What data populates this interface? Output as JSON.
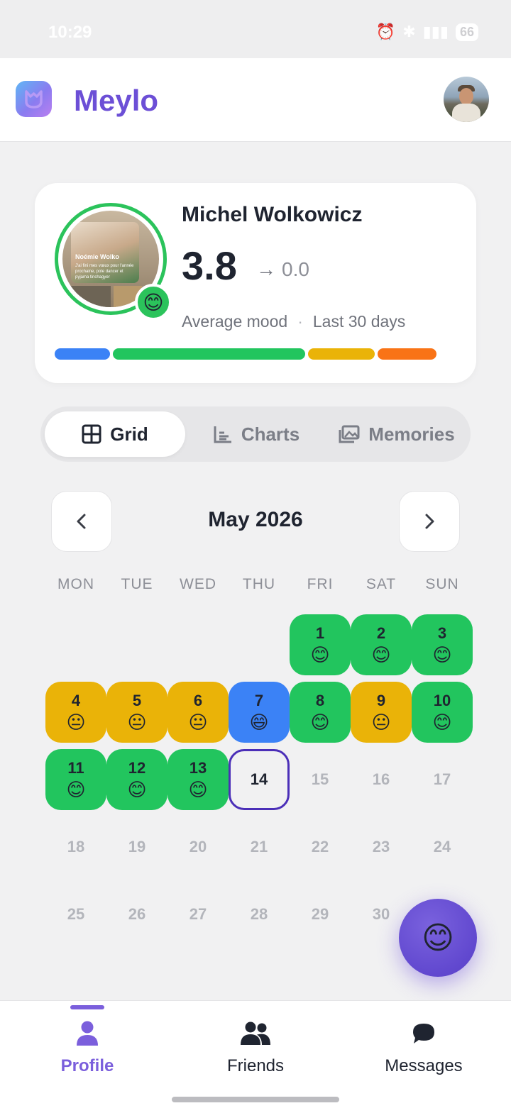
{
  "status_bar": {
    "time": "10:29",
    "battery": "66"
  },
  "app": {
    "title": "Meylo"
  },
  "profile": {
    "name": "Michel Wolkowicz",
    "score": "3.8",
    "delta_arrow": "→",
    "delta": "0.0",
    "caption": "Average mood",
    "separator": "·",
    "period": "Last 30 days",
    "story_mood_emoji": "😊",
    "story_photo_name": "Noémie Wolko",
    "story_photo_caption": "J'ai fini mes vœux pour l'année prochaine, pole dancer et pyjama tinchagyer",
    "distribution": [
      {
        "label": "blue",
        "color": "#3b82f6",
        "fraction": 0.14
      },
      {
        "label": "green",
        "color": "#22c55e",
        "fraction": 0.49
      },
      {
        "label": "yellow",
        "color": "#eab308",
        "fraction": 0.17
      },
      {
        "label": "orange",
        "color": "#f97316",
        "fraction": 0.15
      }
    ]
  },
  "tabs": [
    {
      "label": "Grid",
      "icon": "grid-icon",
      "active": true
    },
    {
      "label": "Charts",
      "icon": "bar-chart-icon",
      "active": false
    },
    {
      "label": "Memories",
      "icon": "photos-icon",
      "active": false
    }
  ],
  "calendar": {
    "month_title": "May 2026",
    "weekdays": [
      "MON",
      "TUE",
      "WED",
      "THU",
      "FRI",
      "SAT",
      "SUN"
    ],
    "first_weekday_index": 4,
    "today": 14,
    "colors": {
      "good": "#22c55e",
      "neutral": "#eab308",
      "great": "#3b82f6"
    },
    "days": [
      {
        "day": "1",
        "mood": "good",
        "emoji": "😊"
      },
      {
        "day": "2",
        "mood": "good",
        "emoji": "😊"
      },
      {
        "day": "3",
        "mood": "good",
        "emoji": "😊"
      },
      {
        "day": "4",
        "mood": "neutral",
        "emoji": "😐"
      },
      {
        "day": "5",
        "mood": "neutral",
        "emoji": "😐"
      },
      {
        "day": "6",
        "mood": "neutral",
        "emoji": "😐"
      },
      {
        "day": "7",
        "mood": "great",
        "emoji": "😄"
      },
      {
        "day": "8",
        "mood": "good",
        "emoji": "😊"
      },
      {
        "day": "9",
        "mood": "neutral",
        "emoji": "😐"
      },
      {
        "day": "10",
        "mood": "good",
        "emoji": "😊"
      },
      {
        "day": "11",
        "mood": "good",
        "emoji": "😊"
      },
      {
        "day": "12",
        "mood": "good",
        "emoji": "😊"
      },
      {
        "day": "13",
        "mood": "good",
        "emoji": "😊"
      },
      {
        "day": "14",
        "mood": "today",
        "emoji": ""
      },
      {
        "day": "15",
        "mood": "none",
        "emoji": ""
      },
      {
        "day": "16",
        "mood": "none",
        "emoji": ""
      },
      {
        "day": "17",
        "mood": "none",
        "emoji": ""
      },
      {
        "day": "18",
        "mood": "none",
        "emoji": ""
      },
      {
        "day": "19",
        "mood": "none",
        "emoji": ""
      },
      {
        "day": "20",
        "mood": "none",
        "emoji": ""
      },
      {
        "day": "21",
        "mood": "none",
        "emoji": ""
      },
      {
        "day": "22",
        "mood": "none",
        "emoji": ""
      },
      {
        "day": "23",
        "mood": "none",
        "emoji": ""
      },
      {
        "day": "24",
        "mood": "none",
        "emoji": ""
      },
      {
        "day": "25",
        "mood": "none",
        "emoji": ""
      },
      {
        "day": "26",
        "mood": "none",
        "emoji": ""
      },
      {
        "day": "27",
        "mood": "none",
        "emoji": ""
      },
      {
        "day": "28",
        "mood": "none",
        "emoji": ""
      },
      {
        "day": "29",
        "mood": "none",
        "emoji": ""
      },
      {
        "day": "30",
        "mood": "none",
        "emoji": ""
      }
    ]
  },
  "fab": {
    "emoji": "😊",
    "icon": "add-mood-icon"
  },
  "bottom_nav": [
    {
      "label": "Profile",
      "icon": "person-icon",
      "active": true
    },
    {
      "label": "Friends",
      "icon": "people-icon",
      "active": false
    },
    {
      "label": "Messages",
      "icon": "chat-bubble-icon",
      "active": false
    }
  ],
  "theme": {
    "accent": "#6c4fd6",
    "today_border": "#4b2fb8"
  }
}
